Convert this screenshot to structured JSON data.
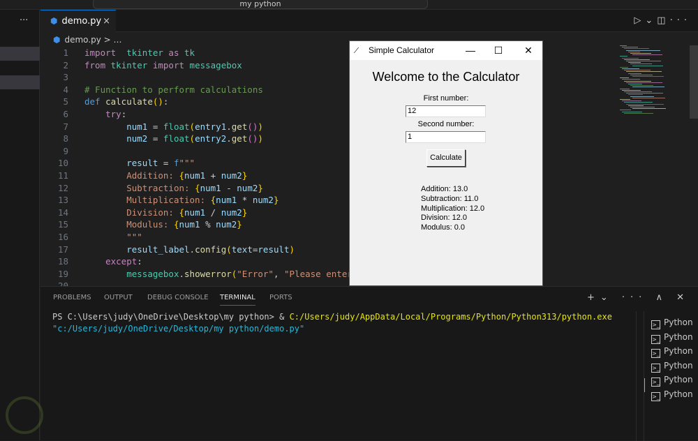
{
  "window": {
    "search_text": "my python"
  },
  "sidebar": {
    "more_label": "···"
  },
  "editor": {
    "tab": {
      "filename": "demo.py",
      "close": "×"
    },
    "breadcrumb": {
      "file": "demo.py",
      "sep": "> …"
    },
    "toolbar": {
      "run": "▷",
      "run_menu": "⌄",
      "split": "◫",
      "more": "···"
    },
    "lines": [
      [
        [
          "kw",
          "import"
        ],
        [
          "",
          "  "
        ],
        [
          "mod",
          "tkinter"
        ],
        [
          "",
          ""
        ],
        [
          "kw",
          " as "
        ],
        [
          "mod",
          "tk"
        ]
      ],
      [
        [
          "kw",
          "from "
        ],
        [
          "mod",
          "tkinter"
        ],
        [
          "kw",
          " import "
        ],
        [
          "mod",
          "messagebox"
        ]
      ],
      [],
      [
        [
          "cm",
          "# Function to perform calculations"
        ]
      ],
      [
        [
          "bl",
          "def "
        ],
        [
          "fn",
          "calculate"
        ],
        [
          "br",
          "()"
        ],
        [
          "",
          ":"
        ]
      ],
      [
        [
          "",
          "    "
        ],
        [
          "kw",
          "try"
        ],
        [
          "",
          ":"
        ]
      ],
      [
        [
          "",
          "        "
        ],
        [
          "v",
          "num1"
        ],
        [
          "",
          " = "
        ],
        [
          "mod",
          "float"
        ],
        [
          "br",
          "("
        ],
        [
          "v",
          "entry1"
        ],
        [
          "",
          "."
        ],
        [
          "fn",
          "get"
        ],
        [
          "br2",
          "()"
        ],
        [
          "br",
          ")"
        ]
      ],
      [
        [
          "",
          "        "
        ],
        [
          "v",
          "num2"
        ],
        [
          "",
          " = "
        ],
        [
          "mod",
          "float"
        ],
        [
          "br",
          "("
        ],
        [
          "v",
          "entry2"
        ],
        [
          "",
          "."
        ],
        [
          "fn",
          "get"
        ],
        [
          "br2",
          "()"
        ],
        [
          "br",
          ")"
        ]
      ],
      [],
      [
        [
          "",
          "        "
        ],
        [
          "v",
          "result"
        ],
        [
          "",
          " = "
        ],
        [
          "bl",
          "f"
        ],
        [
          "s",
          "\"\"\""
        ]
      ],
      [
        [
          "",
          "        "
        ],
        [
          "s",
          "Addition: "
        ],
        [
          "br",
          "{"
        ],
        [
          "v",
          "num1"
        ],
        [
          "",
          " + "
        ],
        [
          "v",
          "num2"
        ],
        [
          "br",
          "}"
        ]
      ],
      [
        [
          "",
          "        "
        ],
        [
          "s",
          "Subtraction: "
        ],
        [
          "br",
          "{"
        ],
        [
          "v",
          "num1"
        ],
        [
          "",
          " - "
        ],
        [
          "v",
          "num2"
        ],
        [
          "br",
          "}"
        ]
      ],
      [
        [
          "",
          "        "
        ],
        [
          "s",
          "Multiplication: "
        ],
        [
          "br",
          "{"
        ],
        [
          "v",
          "num1"
        ],
        [
          "",
          " * "
        ],
        [
          "v",
          "num2"
        ],
        [
          "br",
          "}"
        ]
      ],
      [
        [
          "",
          "        "
        ],
        [
          "s",
          "Division: "
        ],
        [
          "br",
          "{"
        ],
        [
          "v",
          "num1"
        ],
        [
          "",
          " / "
        ],
        [
          "v",
          "num2"
        ],
        [
          "br",
          "}"
        ]
      ],
      [
        [
          "",
          "        "
        ],
        [
          "s",
          "Modulus: "
        ],
        [
          "br",
          "{"
        ],
        [
          "v",
          "num1"
        ],
        [
          "",
          " % "
        ],
        [
          "v",
          "num2"
        ],
        [
          "br",
          "}"
        ]
      ],
      [
        [
          "",
          "        "
        ],
        [
          "s",
          "\"\"\""
        ]
      ],
      [
        [
          "",
          "        "
        ],
        [
          "v",
          "result_label"
        ],
        [
          "",
          "."
        ],
        [
          "fn",
          "config"
        ],
        [
          "br",
          "("
        ],
        [
          "v",
          "text"
        ],
        [
          "",
          "="
        ],
        [
          "v",
          "result"
        ],
        [
          "br",
          ")"
        ]
      ],
      [
        [
          "",
          "    "
        ],
        [
          "kw",
          "except"
        ],
        [
          "",
          ":"
        ]
      ],
      [
        [
          "",
          "        "
        ],
        [
          "mod",
          "messagebox"
        ],
        [
          "",
          "."
        ],
        [
          "fn",
          "showerror"
        ],
        [
          "br",
          "("
        ],
        [
          "s",
          "\"Error\""
        ],
        [
          "",
          ", "
        ],
        [
          "s",
          "\"Please enter"
        ]
      ],
      []
    ]
  },
  "calculator": {
    "title": "Simple Calculator",
    "minimize": "—",
    "maximize": "☐",
    "close": "✕",
    "heading": "Welcome to the Calculator",
    "first_label": "First number:",
    "first_value": "12",
    "second_label": "Second number:",
    "second_value": "1",
    "button": "Calculate",
    "results": [
      "Addition: 13.0",
      "Subtraction: 11.0",
      "Multiplication: 12.0",
      "Division: 12.0",
      "Modulus: 0.0"
    ]
  },
  "panel": {
    "tabs": [
      "PROBLEMS",
      "OUTPUT",
      "DEBUG CONSOLE",
      "TERMINAL",
      "PORTS"
    ],
    "active_tab": "TERMINAL",
    "tools": "+⌄ ··· ∧ ✕",
    "terminal": {
      "prompt": "PS C:\\Users\\judy\\OneDrive\\Desktop\\my python> & ",
      "exe": "C:/Users/judy/AppData/Local/Programs/Python/Python313/python.exe",
      "script": "\"c:/Users/judy/OneDrive/Desktop/my python/demo.py\""
    },
    "terminals": [
      "Python",
      "Python",
      "Python",
      "Python",
      "Python",
      "Python"
    ]
  }
}
